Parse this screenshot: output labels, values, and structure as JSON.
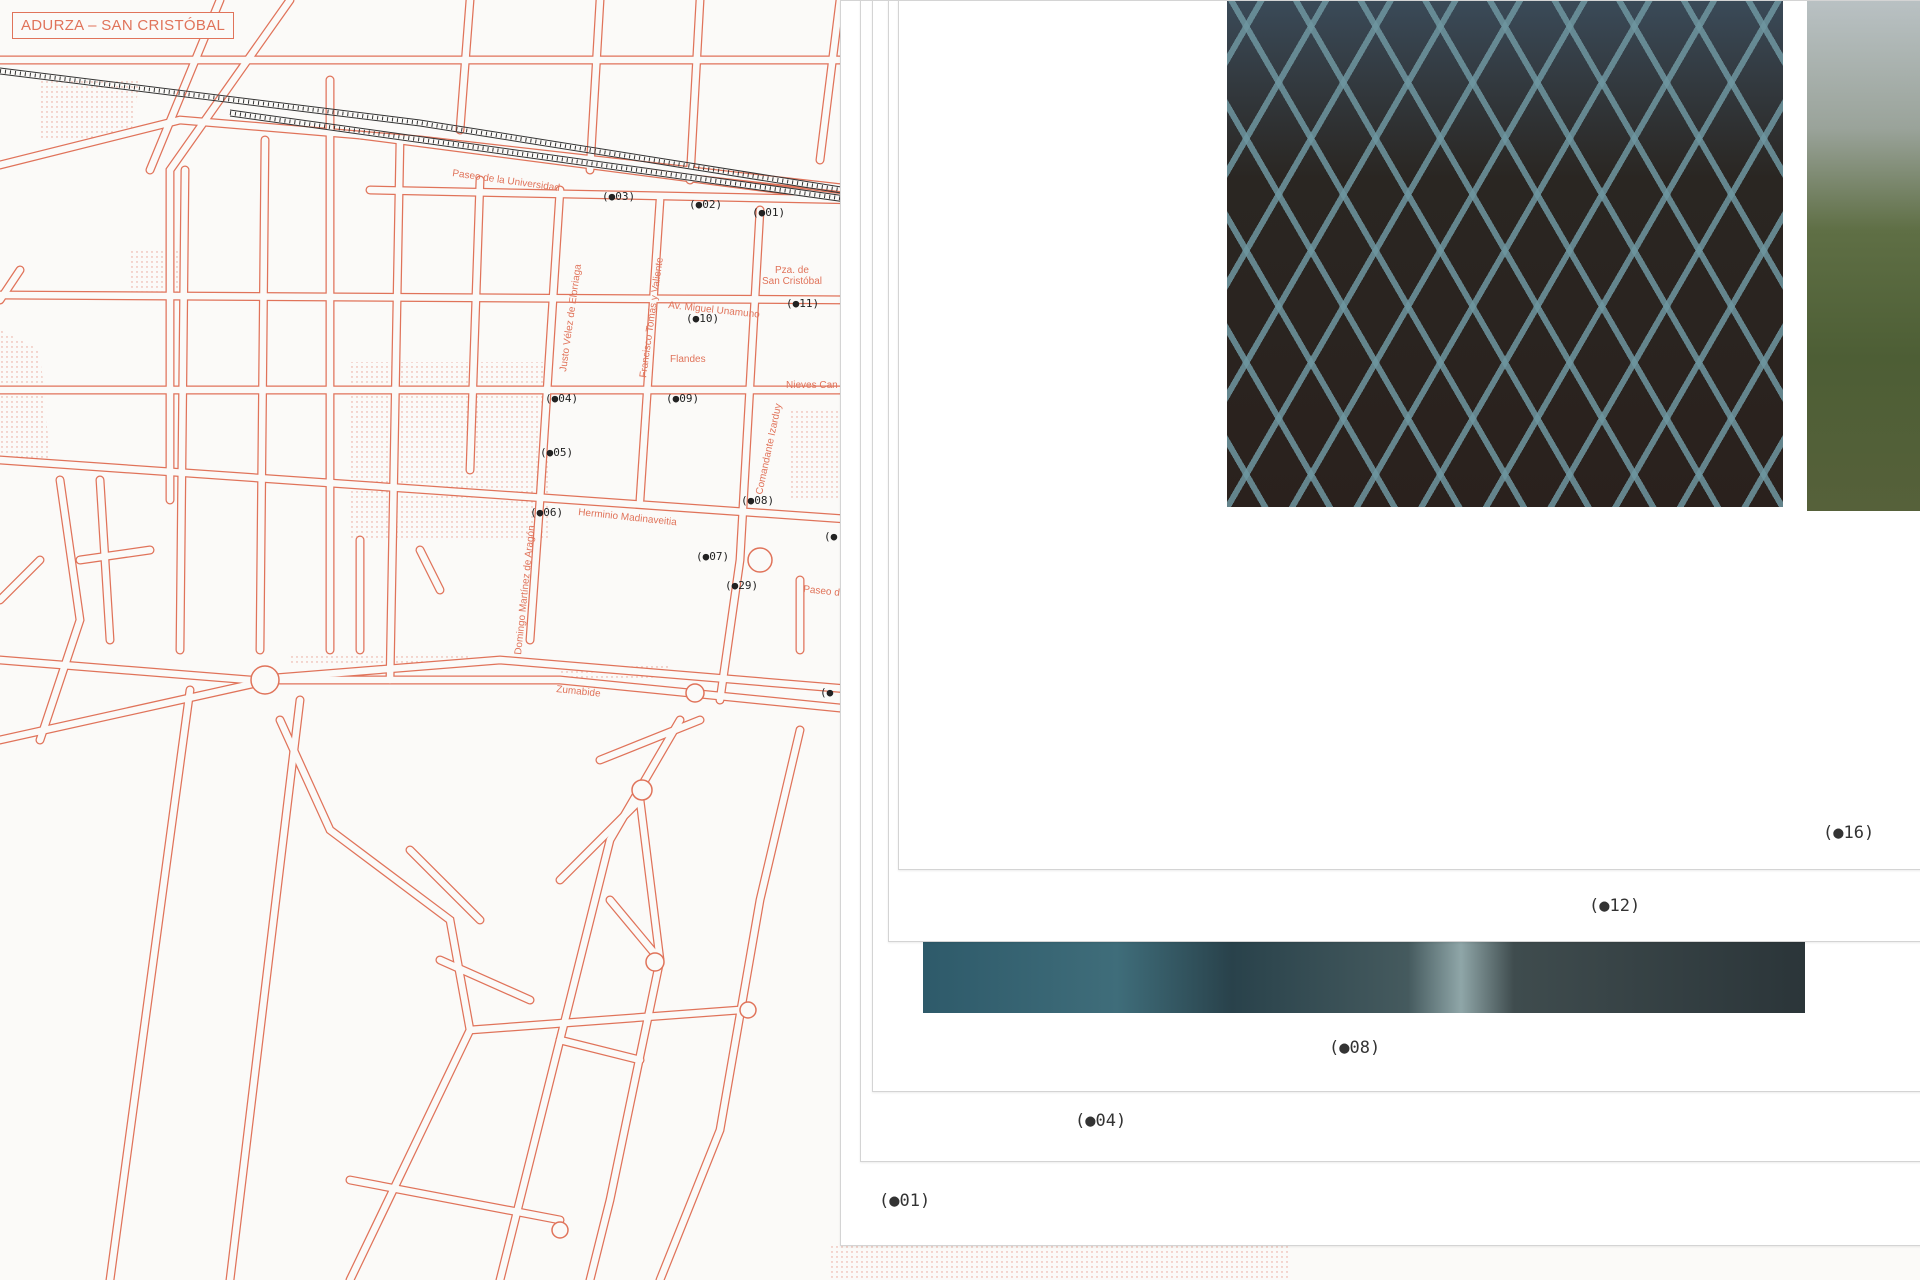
{
  "map": {
    "title": "ADURZA – SAN CRISTÓBAL",
    "street_labels": {
      "paseo_universidad": "Paseo de la Universidad",
      "justo_velez": "Justo Vélez de Elorriaga",
      "francisco_tomas": "Francisco Tomás y Valiente",
      "miguel_unamuno": "Av. Miguel Unamuno",
      "plaza_san_cristobal_1": "Pza. de",
      "plaza_san_cristobal_2": "San Cristóbal",
      "flandes": "Flandes",
      "nieves_cano": "Nieves Can",
      "comandante_izarduy": "Comandante Izarduy",
      "herminio_madinaveitia": "Herminio Madinaveitia",
      "paseo_right": "Paseo d",
      "domingo_martinez": "Domingo Martínez de Aragón",
      "zumabide": "Zumabide"
    },
    "markers": [
      "(●03)",
      "(●02)",
      "(●01)",
      "(●11)",
      "(●10)",
      "(●04)",
      "(●09)",
      "(●05)",
      "(●08)",
      "(●06)",
      "(●07)",
      "(●29)",
      "(●",
      "(●"
    ],
    "colors": {
      "streets": "#e0735a",
      "railway": "#333333",
      "marker": "#222222"
    }
  },
  "photo_sheets": {
    "captions": {
      "sheet_16": "(●16)",
      "sheet_12": "(●12)",
      "sheet_08": "(●08)",
      "sheet_04": "(●04)",
      "sheet_01": "(●01)"
    },
    "photos": [
      "chain-link-fence-over-railway-photo",
      "misty-railway-embankment-photo",
      "blue-pavement-photo"
    ]
  }
}
